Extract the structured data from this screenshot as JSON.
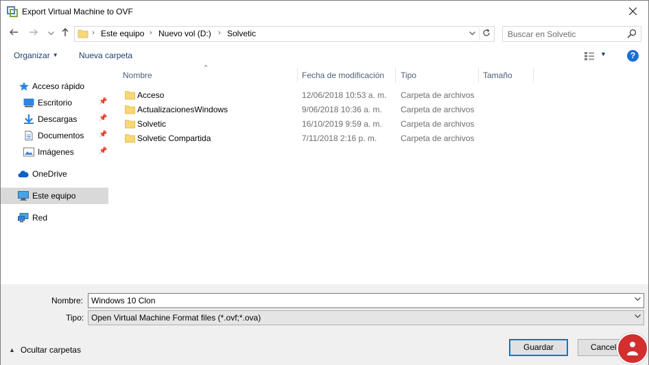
{
  "window": {
    "title": "Export Virtual Machine to OVF"
  },
  "address": {
    "segments": [
      "Este equipo",
      "Nuevo vol (D:)",
      "Solvetic"
    ]
  },
  "search": {
    "placeholder": "Buscar en Solvetic"
  },
  "commands": {
    "organize": "Organizar",
    "new_folder": "Nueva carpeta",
    "help": "?"
  },
  "sidebar": {
    "items": [
      {
        "label": "Acceso rápido",
        "icon": "star-icon"
      },
      {
        "label": "Escritorio",
        "icon": "desktop-icon",
        "pinned": true
      },
      {
        "label": "Descargas",
        "icon": "download-icon",
        "pinned": true
      },
      {
        "label": "Documentos",
        "icon": "document-icon",
        "pinned": true
      },
      {
        "label": "Imágenes",
        "icon": "pictures-icon",
        "pinned": true
      },
      {
        "label": "OneDrive",
        "icon": "cloud-icon"
      },
      {
        "label": "Este equipo",
        "icon": "computer-icon",
        "selected": true
      },
      {
        "label": "Red",
        "icon": "network-icon"
      }
    ]
  },
  "columns": {
    "name": "Nombre",
    "date": "Fecha de modificación",
    "type": "Tipo",
    "size": "Tamaño"
  },
  "files": [
    {
      "name": "Acceso",
      "date": "12/06/2018 10:53 a. m.",
      "type": "Carpeta de archivos"
    },
    {
      "name": "ActualizacionesWindows",
      "date": "9/06/2018 10:36 a. m.",
      "type": "Carpeta de archivos"
    },
    {
      "name": "Solvetic",
      "date": "16/10/2019 9:59 a. m.",
      "type": "Carpeta de archivos"
    },
    {
      "name": "Solvetic Compartida",
      "date": "7/11/2018 2:16 p. m.",
      "type": "Carpeta de archivos"
    }
  ],
  "form": {
    "name_label": "Nombre:",
    "name_value": "Windows 10 Clon",
    "type_label": "Tipo:",
    "type_value": "Open Virtual Machine Format files (*.ovf;*.ova)"
  },
  "footer": {
    "hide_folders": "Ocultar carpetas",
    "save": "Guardar",
    "cancel": "Cancelar"
  },
  "colors": {
    "accent": "#0078d7",
    "link": "#1a3e6e",
    "folder": "#f8d775",
    "selected": "#d9d9d9"
  }
}
